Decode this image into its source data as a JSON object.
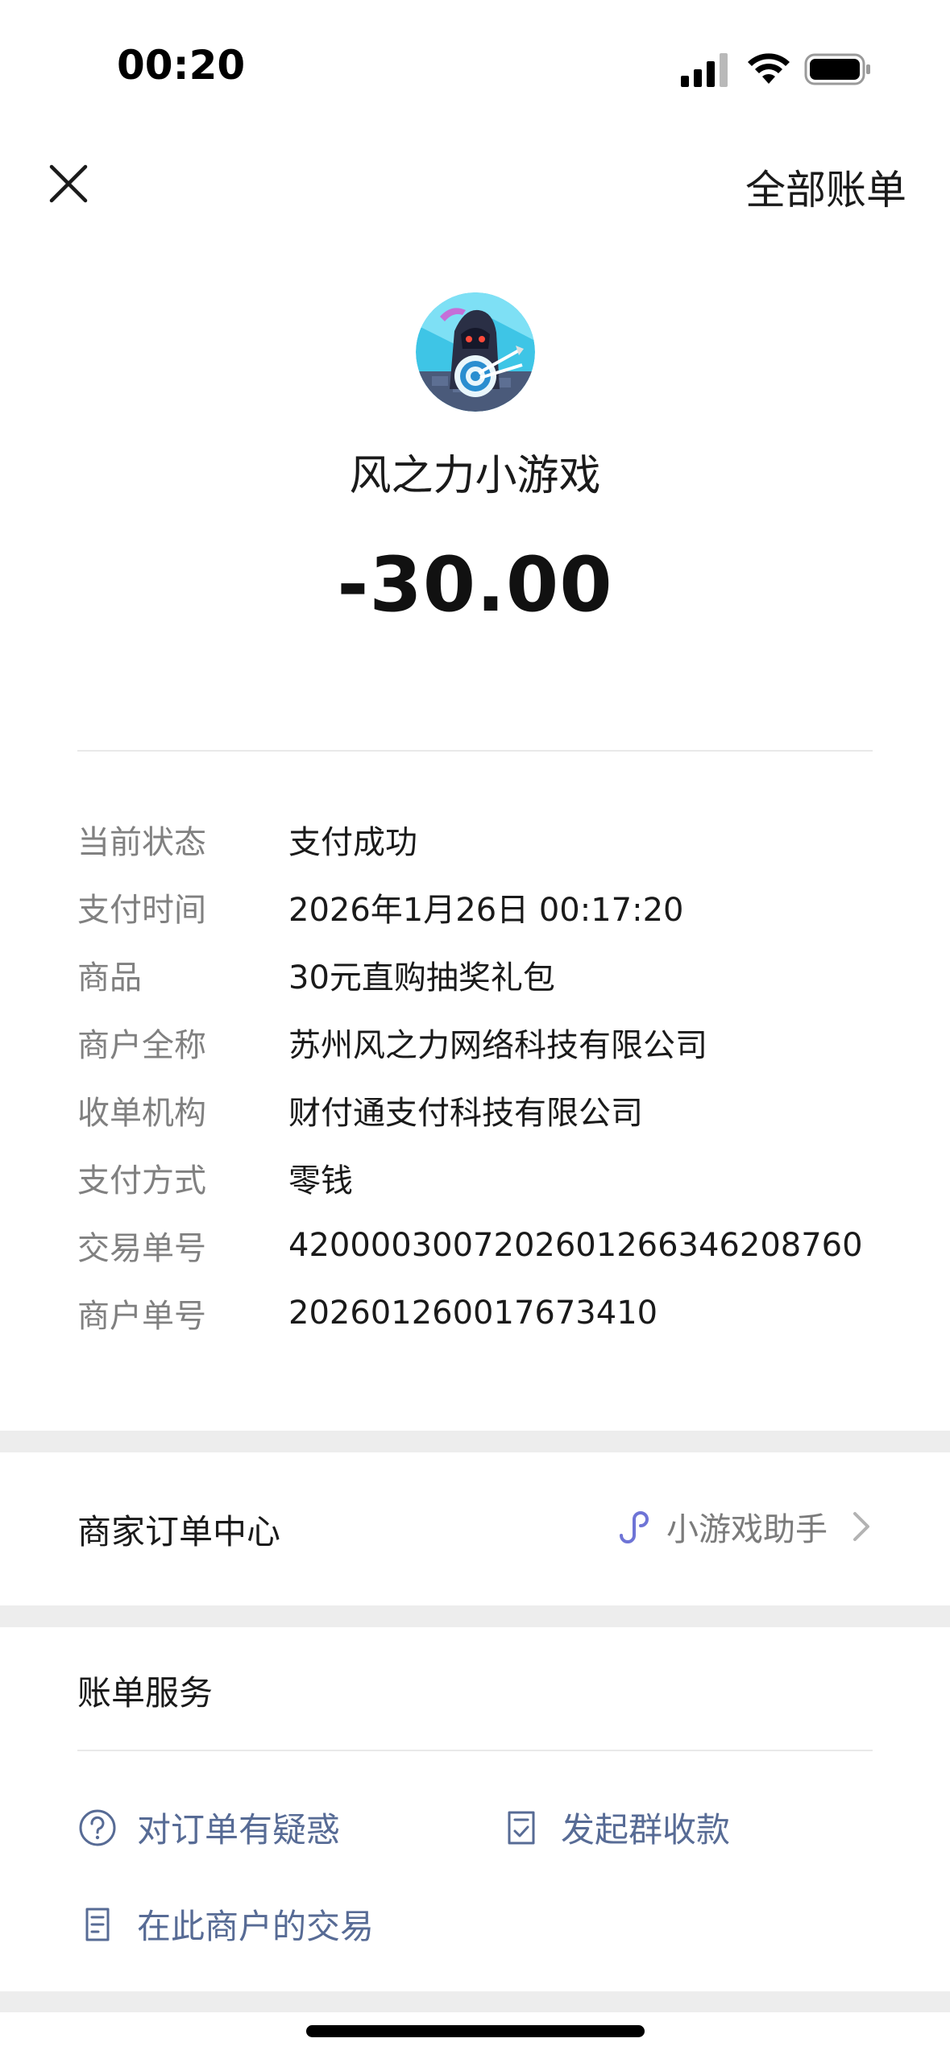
{
  "status_bar": {
    "time": "00:20",
    "icons": [
      "signal-icon",
      "wifi-icon",
      "battery-icon"
    ]
  },
  "nav": {
    "close_icon": "close-icon",
    "all_bills_label": "全部账单"
  },
  "header": {
    "avatar": "game-avatar",
    "merchant_name": "风之力小游戏",
    "amount": "-30.00"
  },
  "details": [
    {
      "label": "当前状态",
      "value": "支付成功"
    },
    {
      "label": "支付时间",
      "value": "2026年1月26日 00:17:20"
    },
    {
      "label": "商品",
      "value": "30元直购抽奖礼包"
    },
    {
      "label": "商户全称",
      "value": "苏州风之力网络科技有限公司"
    },
    {
      "label": "收单机构",
      "value": "财付通支付科技有限公司"
    },
    {
      "label": "支付方式",
      "value": "零钱"
    },
    {
      "label": "交易单号",
      "value": "4200003007202601266346208760"
    },
    {
      "label": "商户单号",
      "value": "20260126001767341​0"
    }
  ],
  "merchant_order": {
    "label": "商家订单中心",
    "link_label": "小游戏助手",
    "link_icon": "mini-program-icon"
  },
  "bill_service": {
    "title": "账单服务",
    "items": [
      {
        "label": "对订单有疑惑",
        "icon": "question-circle-icon"
      },
      {
        "label": "发起群收款",
        "icon": "checklist-icon"
      },
      {
        "label": "在此商户的交易",
        "icon": "document-icon"
      }
    ]
  },
  "colors": {
    "link_blue": "#576b95",
    "label_gray": "#808080",
    "band_gray": "#ededed",
    "mini_program_purple": "#6e74d6"
  }
}
